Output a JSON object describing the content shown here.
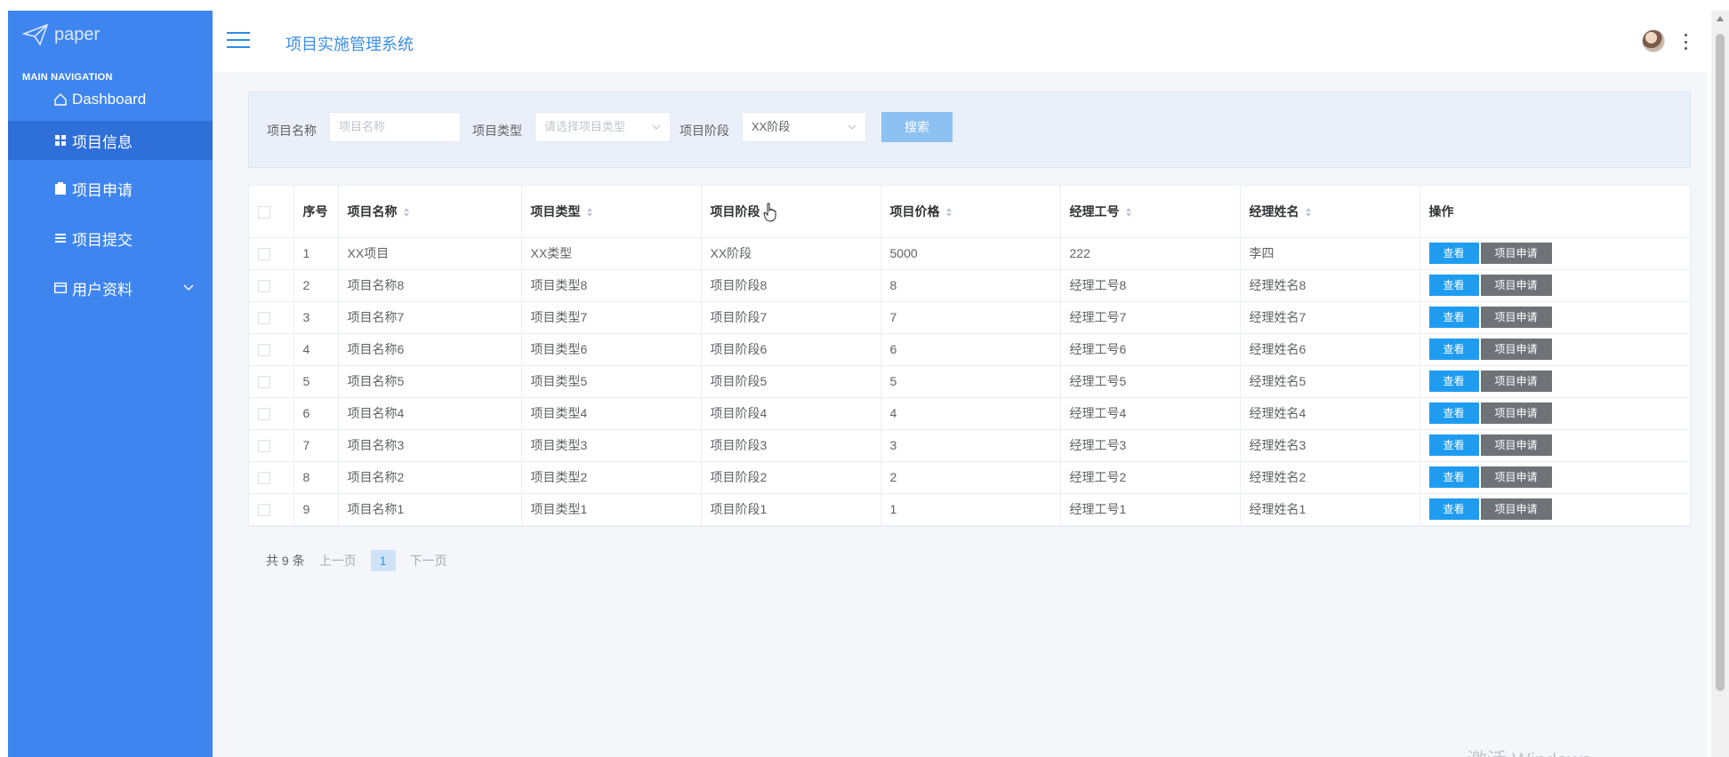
{
  "sidebar": {
    "logo_text": "paper",
    "heading": "MAIN NAVIGATION",
    "items": [
      {
        "label": "Dashboard",
        "icon": "home-icon"
      },
      {
        "label": "项目信息",
        "icon": "grid-icon"
      },
      {
        "label": "项目申请",
        "icon": "clipboard-icon"
      },
      {
        "label": "项目提交",
        "icon": "list-icon"
      },
      {
        "label": "用户资料",
        "icon": "calendar-icon"
      }
    ]
  },
  "header": {
    "title": "项目实施管理系统"
  },
  "search": {
    "name_label": "项目名称",
    "name_placeholder": "项目名称",
    "type_label": "项目类型",
    "type_placeholder": "请选择项目类型",
    "stage_label": "项目阶段",
    "stage_value": "XX阶段",
    "search_button": "搜索"
  },
  "table": {
    "headers": [
      "序号",
      "项目名称",
      "项目类型",
      "项目阶段",
      "项目价格",
      "经理工号",
      "经理姓名",
      "操作"
    ],
    "view_label": "查看",
    "apply_label": "项目申请",
    "rows": [
      [
        "1",
        "XX项目",
        "XX类型",
        "XX阶段",
        "5000",
        "222",
        "李四"
      ],
      [
        "2",
        "项目名称8",
        "项目类型8",
        "项目阶段8",
        "8",
        "经理工号8",
        "经理姓名8"
      ],
      [
        "3",
        "项目名称7",
        "项目类型7",
        "项目阶段7",
        "7",
        "经理工号7",
        "经理姓名7"
      ],
      [
        "4",
        "项目名称6",
        "项目类型6",
        "项目阶段6",
        "6",
        "经理工号6",
        "经理姓名6"
      ],
      [
        "5",
        "项目名称5",
        "项目类型5",
        "项目阶段5",
        "5",
        "经理工号5",
        "经理姓名5"
      ],
      [
        "6",
        "项目名称4",
        "项目类型4",
        "项目阶段4",
        "4",
        "经理工号4",
        "经理姓名4"
      ],
      [
        "7",
        "项目名称3",
        "项目类型3",
        "项目阶段3",
        "3",
        "经理工号3",
        "经理姓名3"
      ],
      [
        "8",
        "项目名称2",
        "项目类型2",
        "项目阶段2",
        "2",
        "经理工号2",
        "经理姓名2"
      ],
      [
        "9",
        "项目名称1",
        "项目类型1",
        "项目阶段1",
        "1",
        "经理工号1",
        "经理姓名1"
      ]
    ]
  },
  "pagination": {
    "total": "共 9 条",
    "prev": "上一页",
    "current": "1",
    "next": "下一页"
  },
  "watermark": "激活 Windows"
}
